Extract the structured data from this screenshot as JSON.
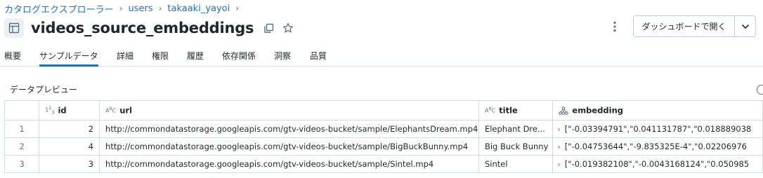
{
  "breadcrumb": {
    "items": [
      "カタログエクスプローラー",
      "users",
      "takaaki_yayoi"
    ],
    "separator": "›"
  },
  "header": {
    "title": "videos_source_embeddings",
    "dashboard_button": "ダッシュボードで開く"
  },
  "tabs": [
    "概要",
    "サンプルデータ",
    "詳細",
    "権限",
    "履歴",
    "依存関係",
    "洞察",
    "品質"
  ],
  "active_tab": "サンプルデータ",
  "preview": {
    "title": "データプレビュー",
    "columns": [
      {
        "name": "id",
        "type_icon": "1²₃"
      },
      {
        "name": "url",
        "type_icon": "AᴮC"
      },
      {
        "name": "title",
        "type_icon": "AᴮC"
      },
      {
        "name": "embedding",
        "type_icon": "struct-icon"
      }
    ],
    "rows": [
      {
        "n": "1",
        "id": "2",
        "url": "http://commondatastorage.googleapis.com/gtv-videos-bucket/sample/ElephantsDream.mp4",
        "title": "Elephant Dre...",
        "embedding": "[\"-0.03394791\",\"0.041131787\",\"0.018889038"
      },
      {
        "n": "2",
        "id": "4",
        "url": "http://commondatastorage.googleapis.com/gtv-videos-bucket/sample/BigBuckBunny.mp4",
        "title": "Big Buck Bunny",
        "embedding": "[\"-0.04753644\",\"-9.835325E-4\",\"0.02206976"
      },
      {
        "n": "3",
        "id": "3",
        "url": "http://commondatastorage.googleapis.com/gtv-videos-bucket/sample/Sintel.mp4",
        "title": "Sintel",
        "embedding": "[\"-0.019382108\",\"-0.0043168124\",\"0.050985"
      }
    ]
  },
  "colors": {
    "link": "#2272b4",
    "text": "#1f272d",
    "muted": "#5f7281",
    "border": "#d1d9e1"
  }
}
